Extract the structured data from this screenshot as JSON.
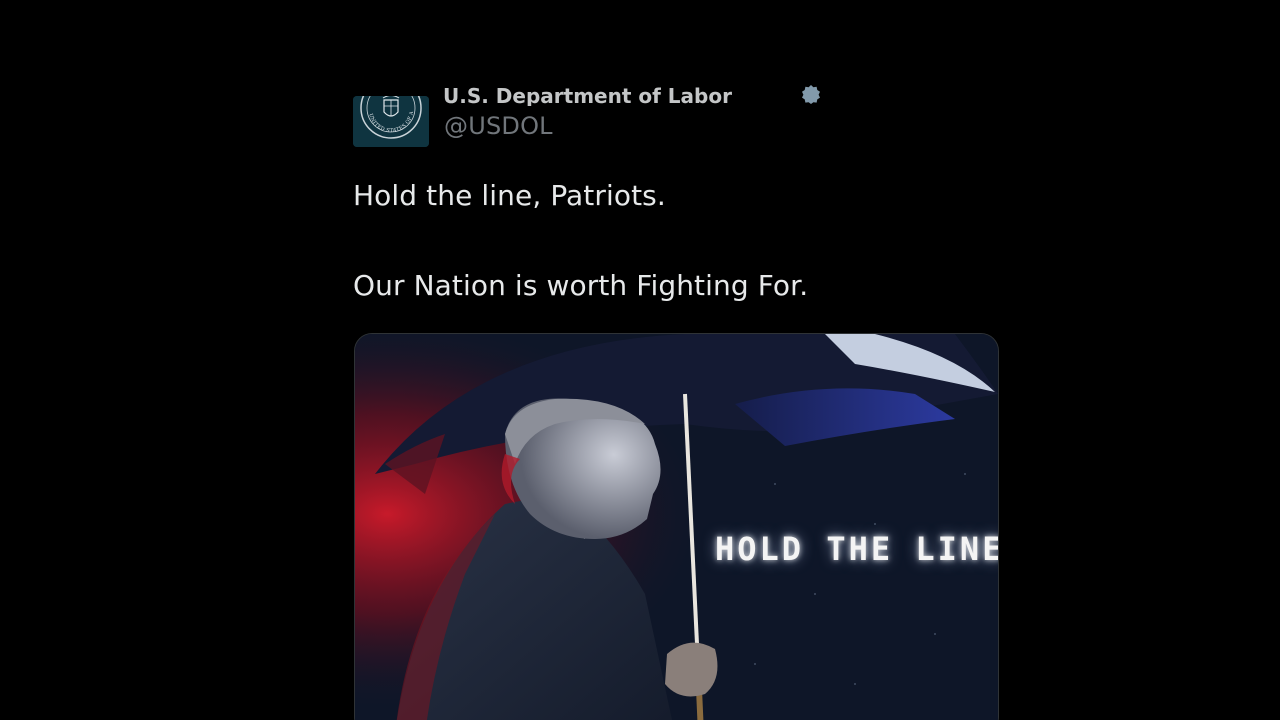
{
  "tweet": {
    "display_name": "U.S. Department of Labor",
    "handle": "@USDOL",
    "text_line_1": "Hold the line, Patriots.",
    "text_line_2": "Our Nation is worth Fighting For.",
    "verified_icon": "verified-badge-icon",
    "avatar_icon": "department-seal-icon",
    "avatar_seal_text": "UNITED STATES OF AMERICA"
  },
  "media": {
    "overlay_text": "HOLD THE LINE."
  },
  "colors": {
    "background": "#000000",
    "text_primary": "#e7e9ea",
    "text_secondary": "#71767b",
    "avatar_bg": "#0f3440",
    "accent_red": "#c0182a",
    "accent_blue": "#1f2b8a"
  }
}
